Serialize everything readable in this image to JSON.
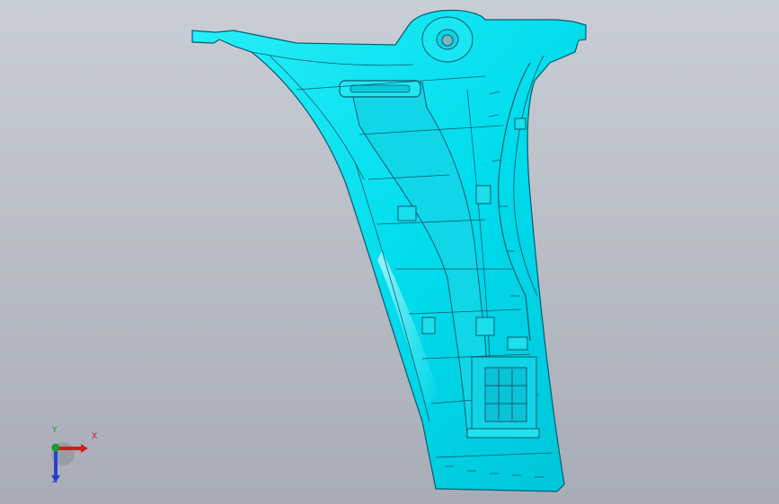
{
  "viewport": {
    "background": [
      "#c9ced6",
      "#a7acb6"
    ],
    "part_color": "#00e2f0",
    "edge_color": "#0a5a6e"
  },
  "triad": {
    "x_label": "X",
    "y_label": "Y",
    "z_label": "Z",
    "x_color": "#d21c1c",
    "y_color": "#1f9a2e",
    "z_color": "#2a3fd1",
    "icon": "coordinate-triad-icon"
  }
}
